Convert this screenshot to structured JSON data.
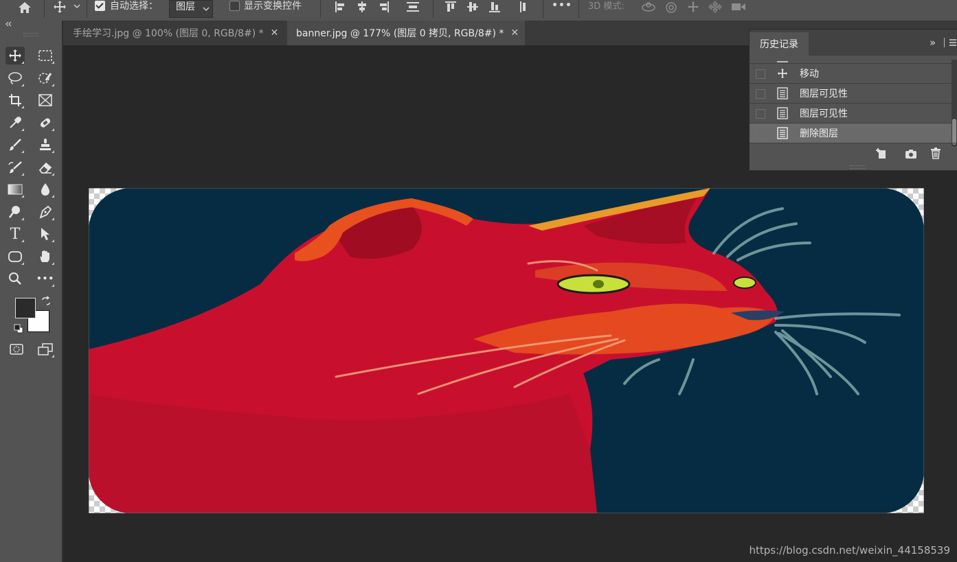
{
  "options_bar": {
    "auto_select_label": "自动选择：",
    "auto_select_checked": true,
    "layer_select_value": "图层",
    "show_transform_label": "显示变换控件",
    "show_transform_checked": false,
    "mode_3d_label": "3D 模式:"
  },
  "tabs": [
    {
      "label": "手绘学习.jpg @ 100% (图层 0, RGB/8#) *",
      "active": false
    },
    {
      "label": "banner.jpg @ 177% (图层 0 拷贝, RGB/8#) *",
      "active": true
    }
  ],
  "tab_close_symbol": "✕",
  "history_panel": {
    "title": "历史记录",
    "collapse_symbol": "»",
    "items": [
      {
        "label": "移动",
        "icon": "move-icon",
        "selected": false
      },
      {
        "label": "图层可见性",
        "icon": "document-icon",
        "selected": false
      },
      {
        "label": "图层可见性",
        "icon": "document-icon",
        "selected": false
      },
      {
        "label": "删除图层",
        "icon": "document-icon",
        "selected": true
      }
    ]
  },
  "tools": {
    "type_glyph": "T",
    "more_glyph": "•••"
  },
  "colors": {
    "foreground": "#2b2b2b",
    "background": "#ffffff",
    "canvas_bg": "#062c44",
    "cat_red": "#c8102e",
    "accent_orange": "#e8501e"
  },
  "watermark": "https://blog.csdn.net/weixin_44158539"
}
